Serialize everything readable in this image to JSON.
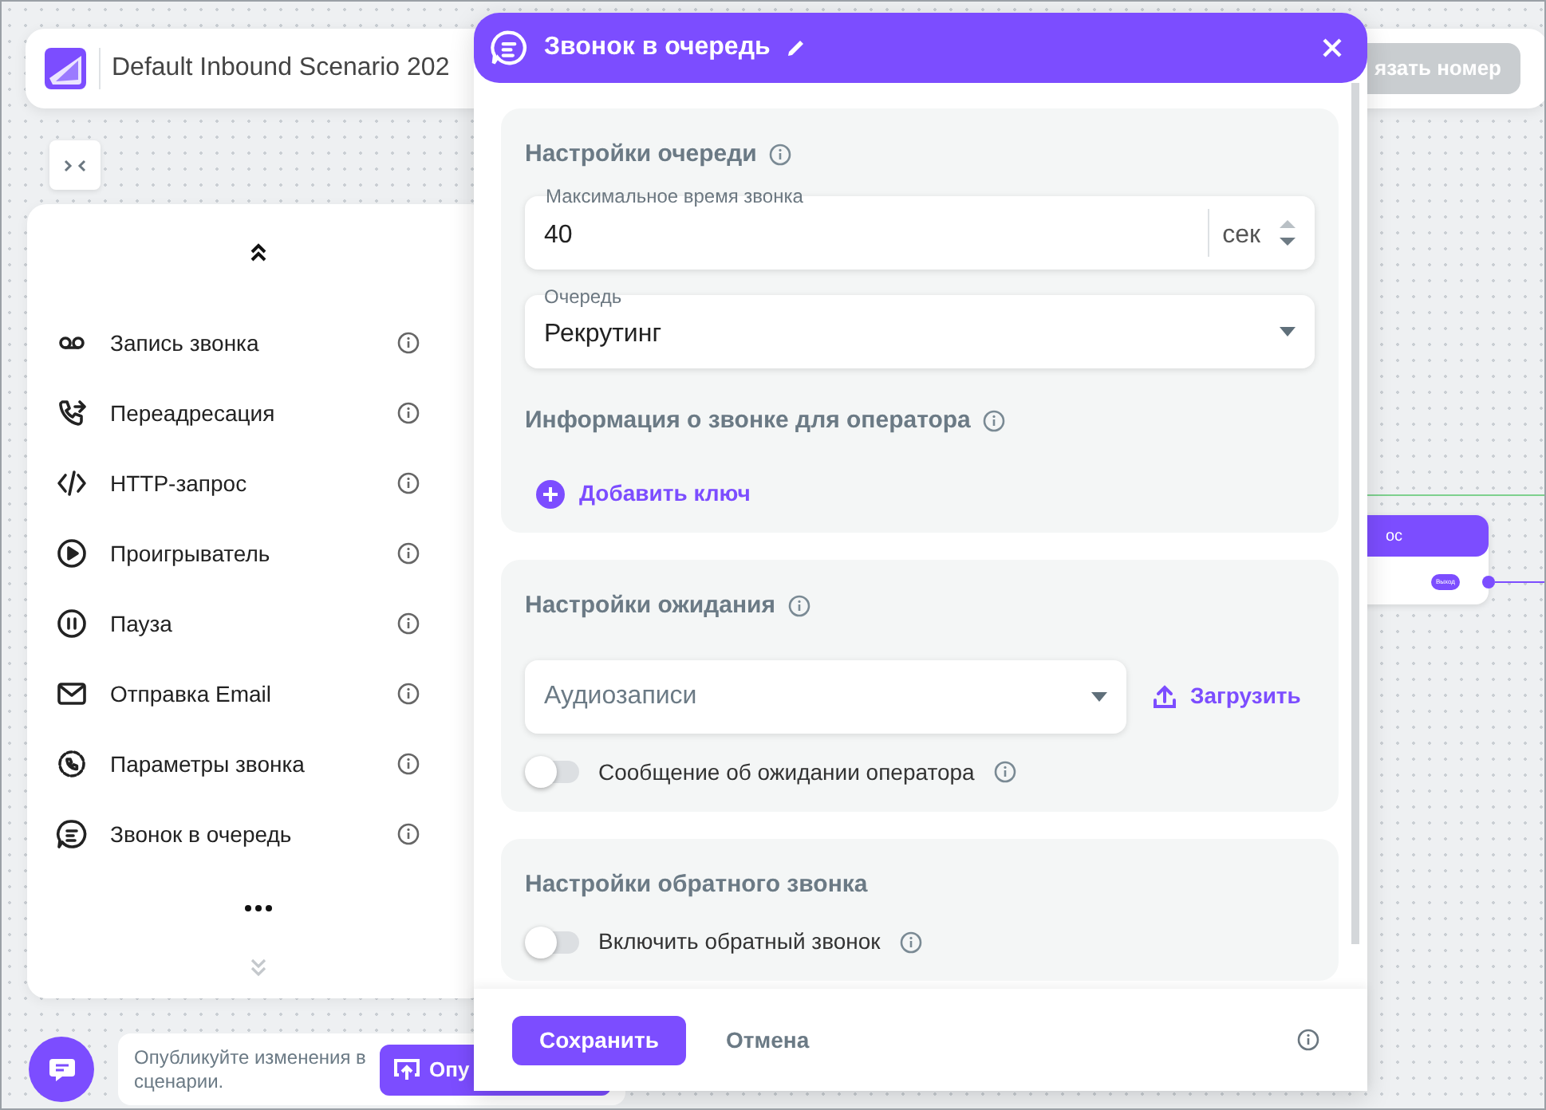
{
  "header": {
    "title": "Default Inbound Scenario 202",
    "action": "язать номер"
  },
  "palette": {
    "items": [
      {
        "label": "Запись звонка"
      },
      {
        "label": "Переадресация"
      },
      {
        "label": "HTTP-запрос"
      },
      {
        "label": "Проигрыватель"
      },
      {
        "label": "Пауза"
      },
      {
        "label": "Отправка Email"
      },
      {
        "label": "Параметры звонка"
      },
      {
        "label": "Звонок в очередь"
      }
    ]
  },
  "canvas_node": {
    "title": "ос",
    "output": "Выход"
  },
  "publish": {
    "message": "Опубликуйте изменения в сценарии.",
    "button": "Опу"
  },
  "modal": {
    "title": "Звонок в очередь",
    "sections": [
      {
        "title": "Настройки очереди",
        "items": [
          {
            "kind": "number",
            "label": "Максимальное время звонка",
            "value": "40",
            "unit": "сек"
          },
          {
            "kind": "select",
            "label": "Очередь",
            "value": "Рекрутинг"
          },
          {
            "kind": "subheading",
            "label": "Информация о звонке для оператора"
          },
          {
            "kind": "add",
            "label": "Добавить ключ"
          }
        ]
      },
      {
        "title": "Настройки ожидания",
        "items": [
          {
            "kind": "upload",
            "placeholder": "Аудиозаписи",
            "button": "Загрузить"
          },
          {
            "kind": "toggle",
            "label": "Сообщение об ожидании оператора",
            "on": false
          }
        ]
      },
      {
        "title": "Настройки обратного звонка",
        "items": [
          {
            "kind": "toggle",
            "label": "Включить обратный звонок",
            "on": false
          }
        ]
      }
    ],
    "save": "Сохранить",
    "cancel": "Отмена"
  }
}
